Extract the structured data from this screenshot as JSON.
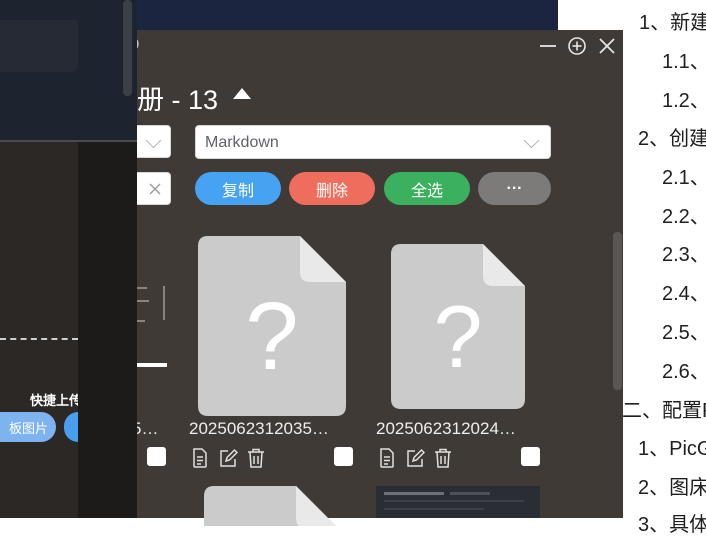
{
  "document": {
    "toc": [
      "1、新建",
      "1.1、",
      "1.2、",
      "2、创建",
      "2.1、",
      "2.2、",
      "2.3、",
      "2.4、",
      "2.5、",
      "2.6、",
      "二、配置P",
      "1、PicG",
      "2、图床",
      "3、具体"
    ]
  },
  "gallery": {
    "titlebar_fragment": "9",
    "album_title": "册 - 13",
    "format_select": {
      "value": "Markdown"
    },
    "buttons": {
      "copy": "复制",
      "delete": "删除",
      "select_all": "全选",
      "more": "···"
    },
    "files": [
      {
        "name_partial": "5…"
      },
      {
        "name": "2025062312035…"
      },
      {
        "name": "2025062312024…"
      }
    ],
    "colors": {
      "copy": "#45a3f2",
      "delete": "#ee6d5d",
      "select_all": "#3bb05e",
      "more": "#7d7b79"
    }
  },
  "left_window": {
    "quick_upload": "快捷上传",
    "paste_button": "板图片"
  }
}
